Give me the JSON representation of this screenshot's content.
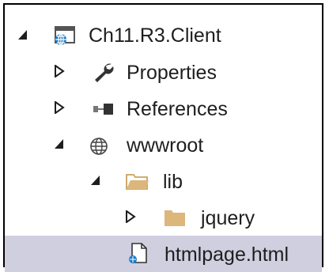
{
  "tree": {
    "items": [
      {
        "label": "Ch11.R3.Client",
        "icon": "web-project-icon",
        "expander": "expanded"
      },
      {
        "label": "Properties",
        "icon": "wrench-icon",
        "expander": "collapsed"
      },
      {
        "label": "References",
        "icon": "references-icon",
        "expander": "collapsed"
      },
      {
        "label": "wwwroot",
        "icon": "globe-folder-icon",
        "expander": "expanded"
      },
      {
        "label": "lib",
        "icon": "folder-open-icon",
        "expander": "expanded"
      },
      {
        "label": "jquery",
        "icon": "folder-icon",
        "expander": "collapsed"
      },
      {
        "label": "htmlpage.html",
        "icon": "html-file-icon",
        "expander": "none",
        "selected": true
      }
    ]
  },
  "colors": {
    "selection": "#cfcfe0",
    "text": "#1e1e1e",
    "folder": "#dcb67a",
    "accent": "#1e7bc8"
  }
}
